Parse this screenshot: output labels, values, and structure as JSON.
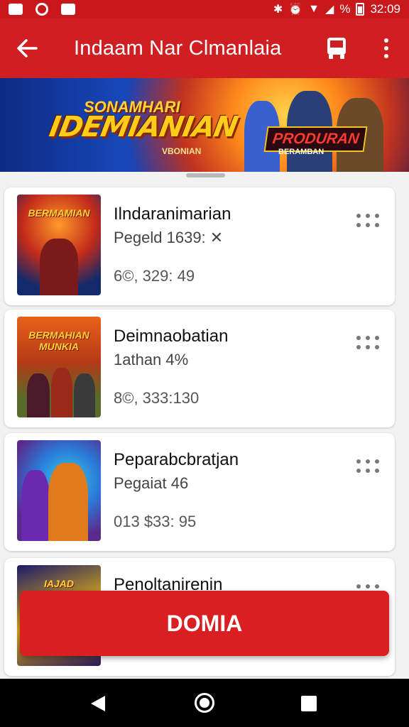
{
  "status_bar": {
    "battery": "%",
    "time": "32:09"
  },
  "app_bar": {
    "title": "Indaam Nar Clmanlaia",
    "back_icon": "arrow-left-icon",
    "bus_icon": "bus-icon",
    "more_icon": "more-vert-icon"
  },
  "banner": {
    "top_text": "SONAMHARI",
    "title": "IDEMIANIAN",
    "small_text": "VBONIAN",
    "badge_title": "PRODURAN",
    "badge_sub": "BERAMBAN"
  },
  "items": [
    {
      "thumb_label": "BERMAMIAN",
      "title": "Ilndaranimarian",
      "subtitle": "Pegeld 1639: ✕",
      "price": "6©, 329: 49"
    },
    {
      "thumb_label": "BERMAHIAN MUNKIA",
      "title": "Deimnaobatian",
      "subtitle": "1athan 4%",
      "price": "8©, 333:130"
    },
    {
      "thumb_label": "",
      "title": "Peparabcbratjan",
      "subtitle": "Pegaiat 46",
      "price": "013 $33: 95"
    },
    {
      "thumb_label": "IAJAD",
      "title": "Penoltanirenin",
      "subtitle": "",
      "price": ""
    }
  ],
  "cta": {
    "label": "DOMIA"
  },
  "nav_bar": {
    "back_icon": "nav-back-icon",
    "home_icon": "nav-home-icon",
    "recent_icon": "nav-recent-icon"
  }
}
